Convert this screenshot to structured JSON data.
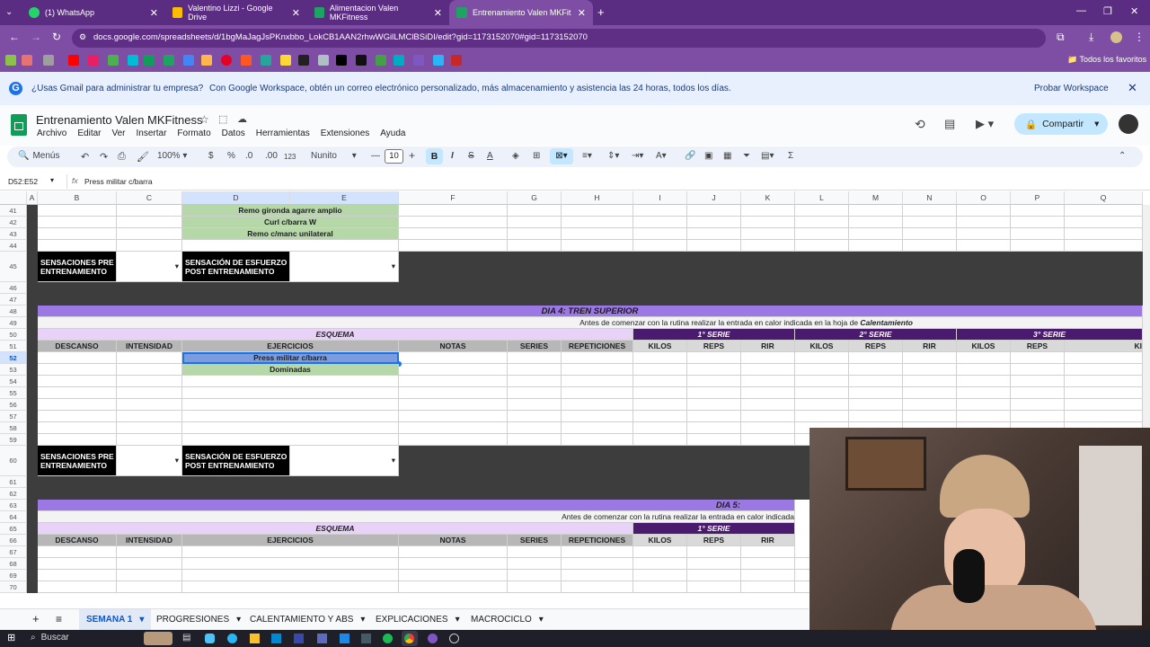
{
  "browser": {
    "tabs": [
      {
        "label": "(1) WhatsApp",
        "color": "#25d366"
      },
      {
        "label": "Valentino Lizzi - Google Drive",
        "color": "#fbbc04"
      },
      {
        "label": "Alimentacion Valen MKFitness",
        "color": "#1ea362"
      },
      {
        "label": "Entrenamiento Valen MKFitness",
        "color": "#1ea362"
      }
    ],
    "url": "docs.google.com/spreadsheets/d/1bgMaJagJsPKnxbbo_LokCB1AAN2rhwWGilLMClBSiDI/edit?gid=1173152070#gid=1173152070",
    "bookmarks_label": "Todos los favoritos"
  },
  "banner": {
    "question": "¿Usas Gmail para administrar tu empresa?",
    "text": "Con Google Workspace, obtén un correo electrónico personalizado, más almacenamiento y asistencia las 24 horas, todos los días.",
    "cta": "Probar Workspace"
  },
  "doc": {
    "title": "Entrenamiento Valen MKFitness",
    "menus": [
      "Archivo",
      "Editar",
      "Ver",
      "Insertar",
      "Formato",
      "Datos",
      "Herramientas",
      "Extensiones",
      "Ayuda"
    ],
    "share": "Compartir"
  },
  "toolbar": {
    "menus": "Menús",
    "zoom": "100%",
    "currency": "$",
    "percent": "%",
    "dec_less": ".0",
    "dec_more": ".00",
    "num": "123",
    "font": "Nunito",
    "size": "10"
  },
  "formula": {
    "ref": "D52:E52",
    "value": "Press militar c/barra"
  },
  "columns": [
    "A",
    "B",
    "C",
    "D",
    "E",
    "F",
    "G",
    "H",
    "I",
    "J",
    "K",
    "L",
    "M",
    "N",
    "O",
    "P",
    "Q"
  ],
  "rows": [
    "41",
    "42",
    "43",
    "44",
    "45",
    "46",
    "47",
    "48",
    "49",
    "50",
    "51",
    "52",
    "53",
    "54",
    "55",
    "56",
    "57",
    "58",
    "59",
    "60",
    "61",
    "62",
    "63",
    "64",
    "65",
    "66",
    "67",
    "68",
    "69",
    "70"
  ],
  "sheet": {
    "ex41": "Remo gironda agarre amplio",
    "ex42": "Curl c/barra W",
    "ex43": "Remo c/manc unilateral",
    "sens_pre": "SENSACIONES PRE ENTRENAMIENTO",
    "sens_post": "SENSACIÓN DE ESFUERZO POST ENTRENAMIENTO",
    "day4": "DIA 4: TREN SUPERIOR",
    "day5": "DIA 5:",
    "note_prefix": "Antes de comenzar con la rutina realizar la entrada en calor indicada en la hoja de",
    "note_bold": "Calentamiento",
    "note_cut": "Antes de comenzar con la rutina realizar la entrada en calor indicada",
    "esquema": "ESQUEMA",
    "serie1": "1° SERIE",
    "serie2": "2° SERIE",
    "serie3": "3° SERIE",
    "h_descanso": "DESCANSO",
    "h_intensidad": "INTENSIDAD",
    "h_ejercicios": "EJERCICIOS",
    "h_notas": "NOTAS",
    "h_series": "SERIES",
    "h_reps": "REPETICIONES",
    "h_kilos": "KILOS",
    "h_reps_s": "REPS",
    "h_rir": "RIR",
    "h_cut": "KI",
    "ex52": "Press militar c/barra",
    "ex53": "Dominadas"
  },
  "sheets": [
    "SEMANA 1",
    "PROGRESIONES",
    "CALENTAMIENTO Y ABS",
    "EXPLICACIONES",
    "MACROCICLO"
  ],
  "taskbar": {
    "search": "Buscar"
  }
}
